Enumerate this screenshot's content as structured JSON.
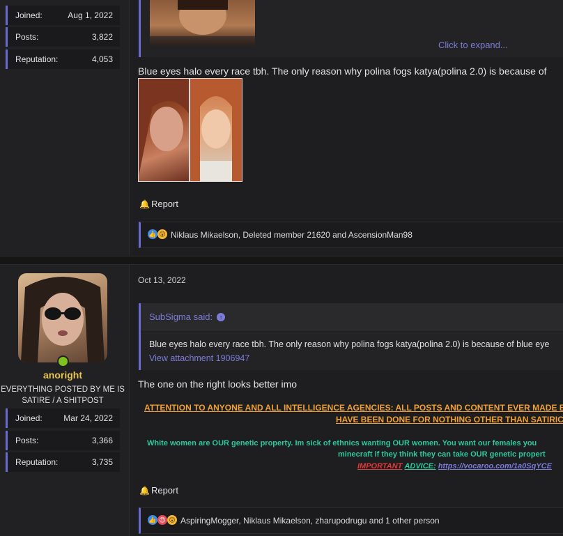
{
  "post1": {
    "stats": [
      {
        "label": "Joined:",
        "value": "Aug 1, 2022"
      },
      {
        "label": "Posts:",
        "value": "3,822"
      },
      {
        "label": "Reputation:",
        "value": "4,053"
      }
    ],
    "expand_label": "Click to expand...",
    "message": "Blue eyes halo every race tbh. The only reason why polina fogs katya(polina 2.0) is because of",
    "report_label": "Report",
    "reactions_text": "Niklaus Mikaelson, Deleted member 21620 and AscensionMan98"
  },
  "post2": {
    "username": "anoright",
    "user_title": "EVERYTHING POSTED BY ME IS SATIRE / A SHITPOST",
    "stats": [
      {
        "label": "Joined:",
        "value": "Mar 24, 2022"
      },
      {
        "label": "Posts:",
        "value": "3,366"
      },
      {
        "label": "Reputation:",
        "value": "3,735"
      }
    ],
    "date": "Oct 13, 2022",
    "quote_author": "SubSigma said:",
    "quote_text": "Blue eyes halo every race tbh. The only reason why polina fogs katya(polina 2.0) is because of blue eye",
    "attachment_link": "View attachment 1906947",
    "message": "The one on the right looks better imo",
    "signature": {
      "line1": "ATTENTION TO ANYONE AND ALL INTELLIGENCE AGENCIES: ALL POSTS AND CONTENT EVER MADE BY THIS I",
      "line2": "HAVE BEEN DONE FOR NOTHING OTHER THAN SATIRICAL",
      "line3": "White women are OUR genetic property. Im sick of ethnics wanting OUR women. You want our females you",
      "line4": "minecraft if they think they can take OUR genetic propert",
      "important": "IMPORTANT",
      "advice": "ADVICE:",
      "link": "https://vocaroo.com/1a0SqYCE"
    },
    "report_label": "Report",
    "reactions_text": "AspiringMogger, Niklaus Mikaelson, zharupodrugu and 1 other person"
  },
  "colors": {
    "accent": "#6a6ad0",
    "link": "#7b7bd8",
    "username": "#e8c54a",
    "online": "#7fc21f"
  }
}
